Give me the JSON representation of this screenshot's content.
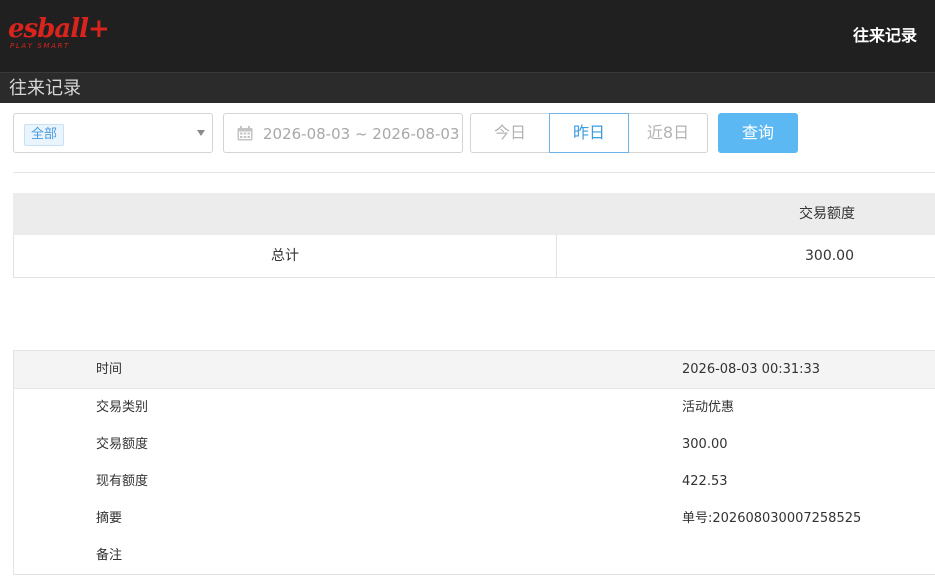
{
  "header": {
    "logo_text": "esball+",
    "logo_tagline": "PLAY SMART",
    "title": "往来记录"
  },
  "subbar": {
    "title": "往来记录"
  },
  "filters": {
    "type_select": {
      "selected": "全部"
    },
    "date_range": "2026-08-03 ~ 2026-08-03",
    "quick_ranges": [
      {
        "label": "今日",
        "active": false
      },
      {
        "label": "昨日",
        "active": true
      },
      {
        "label": "近8日",
        "active": false
      }
    ],
    "query_label": "查询"
  },
  "summary": {
    "column_header": "交易额度",
    "total_label": "总计",
    "total_value": "300.00"
  },
  "detail": {
    "rows": [
      {
        "label": "时间",
        "value": "2026-08-03 00:31:33"
      },
      {
        "label": "交易类别",
        "value": "活动优惠"
      },
      {
        "label": "交易额度",
        "value": "300.00"
      },
      {
        "label": "现有额度",
        "value": "422.53"
      },
      {
        "label": "摘要",
        "value": "单号:202608030007258525"
      },
      {
        "label": "备注",
        "value": ""
      }
    ]
  },
  "colors": {
    "header_bg": "#202020",
    "brand_red": "#d9231d",
    "accent_blue": "#5cb8f2",
    "active_text": "#3d9be0"
  }
}
